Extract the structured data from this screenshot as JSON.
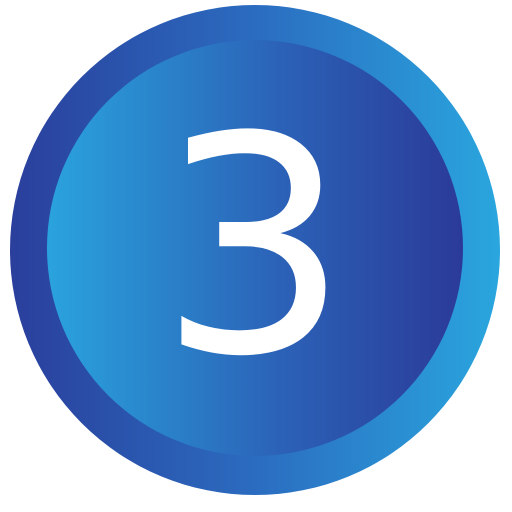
{
  "badge": {
    "number": "3",
    "colors": {
      "outer_ring_left": "#2a3f9c",
      "outer_ring_right": "#2aa6de",
      "inner_fill_left": "#2aa3dd",
      "inner_fill_right": "#2b3a98",
      "digit": "#ffffff",
      "background": "#ffffff"
    }
  }
}
